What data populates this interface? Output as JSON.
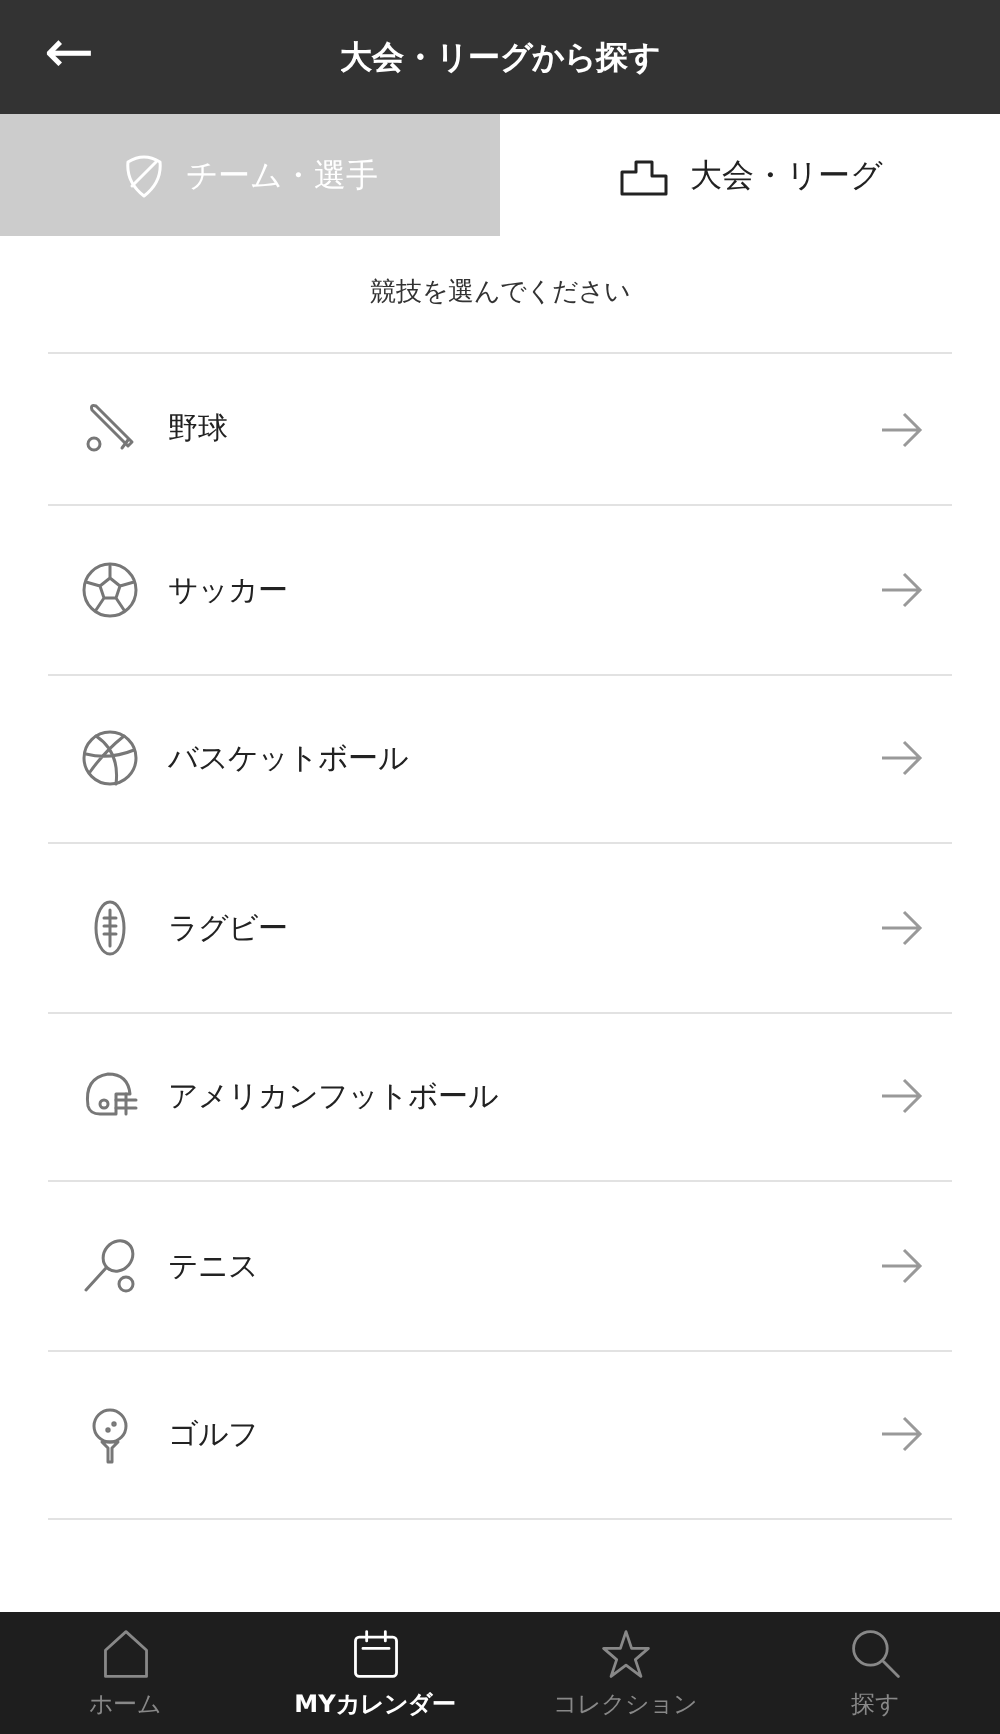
{
  "header": {
    "back": "←",
    "title": "大会・リーグから探す"
  },
  "tabs": [
    {
      "label": "チーム・選手",
      "kind": "team",
      "selected": false
    },
    {
      "label": "大会・リーグ",
      "kind": "league",
      "selected": true
    }
  ],
  "prompt": "競技を選んでください",
  "sports": [
    {
      "label": "野球",
      "kind": "baseball"
    },
    {
      "label": "サッカー",
      "kind": "soccer"
    },
    {
      "label": "バスケットボール",
      "kind": "basketball"
    },
    {
      "label": "ラグビー",
      "kind": "rugby"
    },
    {
      "label": "アメリカンフットボール",
      "kind": "football"
    },
    {
      "label": "テニス",
      "kind": "tennis"
    },
    {
      "label": "ゴルフ",
      "kind": "golf"
    }
  ],
  "bottom_nav": [
    {
      "label": "ホーム",
      "kind": "home",
      "selected": false
    },
    {
      "label": "MYカレンダー",
      "kind": "calendar",
      "selected": true
    },
    {
      "label": "コレクション",
      "kind": "star",
      "selected": false
    },
    {
      "label": "探す",
      "kind": "search",
      "selected": false
    }
  ]
}
